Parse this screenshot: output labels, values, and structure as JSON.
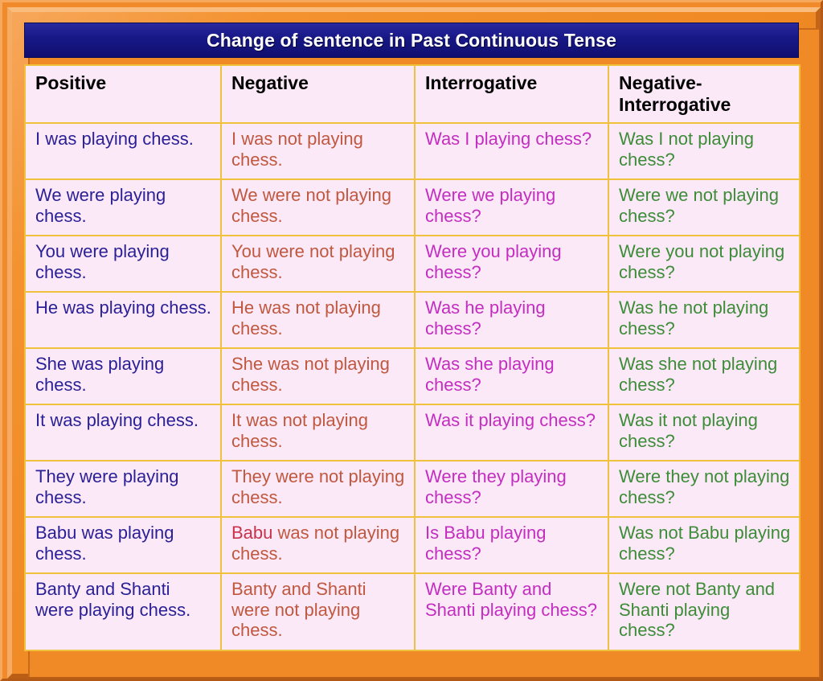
{
  "title": "Change of sentence in Past Continuous Tense",
  "colors": {
    "frame": "#ef8a26",
    "title_bar": "#171787",
    "title_text": "#ffffff",
    "cell_background": "#fce9f8",
    "cell_border": "#f0c23c",
    "header_text": "#000000",
    "positive_text": "#2b2197",
    "negative_text": "#c0583f",
    "interrogative_text": "#c32ec0",
    "negative_interrogative_text": "#3c8c38"
  },
  "table": {
    "headers": [
      "Positive",
      "Negative",
      "Interrogative",
      "Negative-\nInterrogative"
    ],
    "header_line1": "Negative-",
    "header_line2": "Interrogative",
    "rows": [
      {
        "positive": "I was playing chess.",
        "negative": "I was not playing chess.",
        "interrogative": "Was I playing chess?",
        "negative_interrogative": "Was I not playing chess?"
      },
      {
        "positive": "We were playing chess.",
        "negative": "We were not playing chess.",
        "interrogative": "Were we playing chess?",
        "negative_interrogative": "Were we not playing chess?"
      },
      {
        "positive": "You were playing chess.",
        "negative": "You were not playing chess.",
        "interrogative": "Were you playing chess?",
        "negative_interrogative": "Were you not playing chess?"
      },
      {
        "positive": "He was playing chess.",
        "negative": "He was not playing chess.",
        "interrogative": "Was he playing chess?",
        "negative_interrogative": "Was he not playing chess?"
      },
      {
        "positive": "She was playing chess.",
        "negative": "She was not playing chess.",
        "interrogative": "Was she playing chess?",
        "negative_interrogative": "Was she not playing chess?"
      },
      {
        "positive": "It was playing chess.",
        "negative": "It was not playing chess.",
        "interrogative": "Was it playing chess?",
        "negative_interrogative": "Was it not playing chess?"
      },
      {
        "positive": "They were playing chess.",
        "negative": "They were not playing chess.",
        "interrogative": "Were they playing chess?",
        "negative_interrogative": "Were they not playing chess?"
      },
      {
        "positive": "Babu was playing chess.",
        "negative": "Babu was not playing chess.",
        "interrogative": "Is Babu playing chess?",
        "negative_interrogative": "Was not Babu playing chess?"
      },
      {
        "positive": "Banty and Shanti were playing chess.",
        "negative": "Banty and Shanti were not playing chess.",
        "interrogative": "Were Banty and Shanti playing chess?",
        "negative_interrogative": "Were not Banty and Shanti playing chess?"
      }
    ]
  }
}
